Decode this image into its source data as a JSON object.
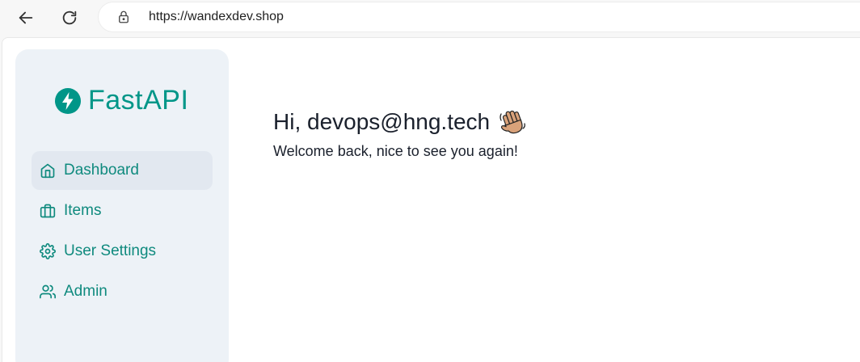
{
  "browser": {
    "url": "https://wandexdev.shop",
    "back_icon": "arrow-left-icon",
    "reload_icon": "reload-icon",
    "lock_icon": "lock-icon"
  },
  "sidebar": {
    "logo_text": "FastAPI",
    "logo_icon": "fastapi-bolt-icon",
    "items": [
      {
        "label": "Dashboard",
        "icon": "home-icon",
        "active": true
      },
      {
        "label": "Items",
        "icon": "briefcase-icon",
        "active": false
      },
      {
        "label": "User Settings",
        "icon": "gear-icon",
        "active": false
      },
      {
        "label": "Admin",
        "icon": "users-icon",
        "active": false
      }
    ]
  },
  "main": {
    "greeting": "Hi, devops@hng.tech",
    "greeting_emoji": "waving-hand-icon",
    "subtitle": "Welcome back, nice to see you again!"
  },
  "colors": {
    "accent": "#009688",
    "sidebar_bg": "#edf2f7",
    "active_item_bg": "#e2e8f0",
    "text": "#1a202c"
  }
}
